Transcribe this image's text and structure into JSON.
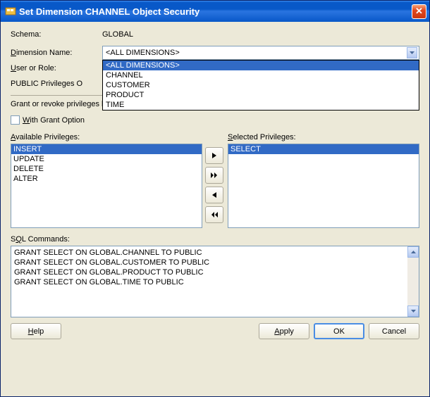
{
  "title": "Set Dimension CHANNEL Object Security",
  "labels": {
    "schema": "Schema:",
    "dimension_name": "Dimension Name:",
    "user_or_role": "User or Role:",
    "public_privileges": "PUBLIC Privileges O",
    "instructions": "Grant or revoke privileges by moving the available privileges to/from the selected privileges",
    "with_grant_option": "With Grant Option",
    "available_privileges": "Available Privileges:",
    "selected_privileges": "Selected Privileges:",
    "sql_commands": "SQL Commands:"
  },
  "schema_value": "GLOBAL",
  "dimension_combo": {
    "value": "<ALL DIMENSIONS>",
    "options": [
      "<ALL DIMENSIONS>",
      "CHANNEL",
      "CUSTOMER",
      "PRODUCT",
      "TIME"
    ]
  },
  "with_grant_checked": false,
  "available": [
    "INSERT",
    "UPDATE",
    "DELETE",
    "ALTER"
  ],
  "selected": [
    "SELECT"
  ],
  "sql": [
    "GRANT SELECT ON GLOBAL.CHANNEL TO PUBLIC",
    "GRANT SELECT ON GLOBAL.CUSTOMER TO PUBLIC",
    "GRANT SELECT ON GLOBAL.PRODUCT TO PUBLIC",
    "GRANT SELECT ON GLOBAL.TIME TO PUBLIC"
  ],
  "buttons": {
    "help": "Help",
    "apply": "Apply",
    "ok": "OK",
    "cancel": "Cancel"
  }
}
